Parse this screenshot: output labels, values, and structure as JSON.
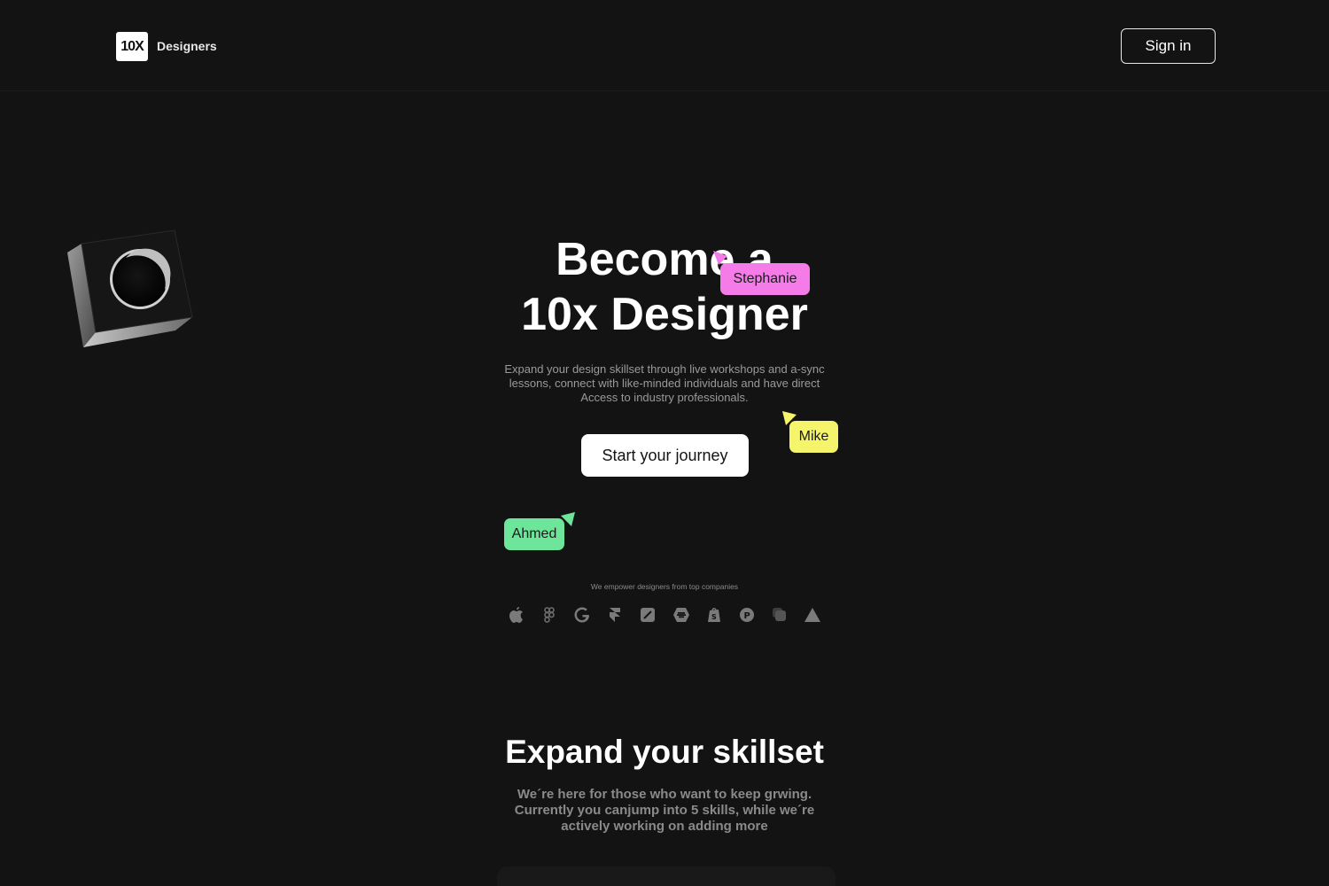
{
  "header": {
    "logo_mark": "10X",
    "logo_text": "Designers",
    "signin_label": "Sign in"
  },
  "hero": {
    "title_line1": "Become a",
    "title_line2": "10x Designer",
    "subtitle": "Expand your design skillset through live workshops and a-sync lessons, connect with like-minded individuals and have direct Access to industry professionals.",
    "cta_label": "Start your journey"
  },
  "cursors": [
    {
      "name": "Stephanie",
      "color": "#f57ce8"
    },
    {
      "name": "Mike",
      "color": "#f6f46a"
    },
    {
      "name": "Ahmed",
      "color": "#6de59a"
    }
  ],
  "companies": {
    "label": "We empower designers from top companies",
    "icons": [
      "apple-icon",
      "figma-icon",
      "google-icon",
      "framer-icon",
      "sketch-icon",
      "bumble-icon",
      "shopify-icon",
      "producthunt-icon",
      "stack-icon",
      "vercel-icon"
    ]
  },
  "skills": {
    "title": "Expand your skillset",
    "subtitle": "We´re here for those who want to keep grwing. Currently you canjump into 5 skills, while we´re actively working on adding more"
  },
  "colors": {
    "background": "#131313",
    "stephanie": "#f57ce8",
    "mike": "#f6f46a",
    "ahmed": "#6de59a"
  }
}
